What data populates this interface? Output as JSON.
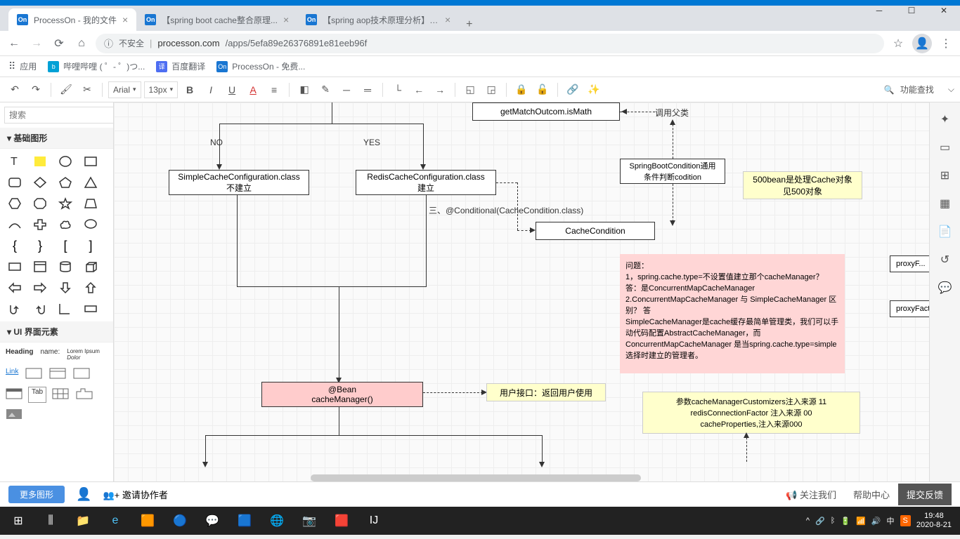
{
  "tabs": [
    {
      "title": "ProcessOn - 我的文件",
      "active": true
    },
    {
      "title": "【spring boot cache整合原理...",
      "active": false
    },
    {
      "title": "【spring aop技术原理分析】- ...",
      "active": false
    }
  ],
  "url": {
    "warn": "不安全",
    "host": "processon.com",
    "path": "/apps/5efa89e26376891e81eeb96f"
  },
  "bookmarks": {
    "apps": "应用",
    "b1": "哔哩哔哩 ( ゜- ゜)つ...",
    "b2": "百度翻译",
    "b3": "ProcessOn - 免费..."
  },
  "toolbar": {
    "font": "Arial",
    "size": "13px",
    "search": "功能查找"
  },
  "sidebar": {
    "search_ph": "搜索",
    "panel1": "基础图形",
    "panel2": "UI 界面元素",
    "more": "更多图形",
    "ui": {
      "heading": "Heading",
      "name": "name:",
      "lorem": "Lorem Ipsum",
      "link": "Link",
      "tab": "Tab"
    }
  },
  "diagram": {
    "getMatch": "getMatchOutcom.isMath",
    "callParent": "调用父类",
    "no": "NO",
    "yes": "YES",
    "simpleCache": "SimpleCacheConfiguration.class 不建立",
    "redisCache": "RedisCacheConfiguration.class 建立",
    "conditional": "三、@Conditional(CacheCondition.class)",
    "cacheCondition": "CacheCondition",
    "springBoot": "SpringBootCondition通用条件判断codition",
    "note500": "500bean是处理Cache对象见500对象",
    "questions": "问题：\n1，spring.cache.type=不设置值建立那个cacheManager？  答：是ConcurrentMapCacheManager\n2.ConcurrentMapCacheManager 与 SimpleCacheManager 区别？ 答\nSimpleCacheManager是cache缓存最简单管理类，我们可以手动代码配置AbstractCacheManager，而ConcurrentMapCacheManager 是当spring.cache.type=simple 选择时建立的管理者。",
    "bean": "@Bean\ncacheManager()",
    "userInterface": "用户接口：返回用户使用",
    "params": "参数cacheManagerCustomizers注入来源 11\nredisConnectionFactor 注入来源 00\ncacheProperties,注入来源000",
    "proxyF": "proxyF...",
    "proxyFacto": "proxyFacto..."
  },
  "footer": {
    "invite": "邀请协作者",
    "follow": "关注我们",
    "help": "帮助中心",
    "feedback": "提交反馈"
  },
  "tray": {
    "ime": "中",
    "time": "19:48",
    "date": "2020-8-21"
  }
}
